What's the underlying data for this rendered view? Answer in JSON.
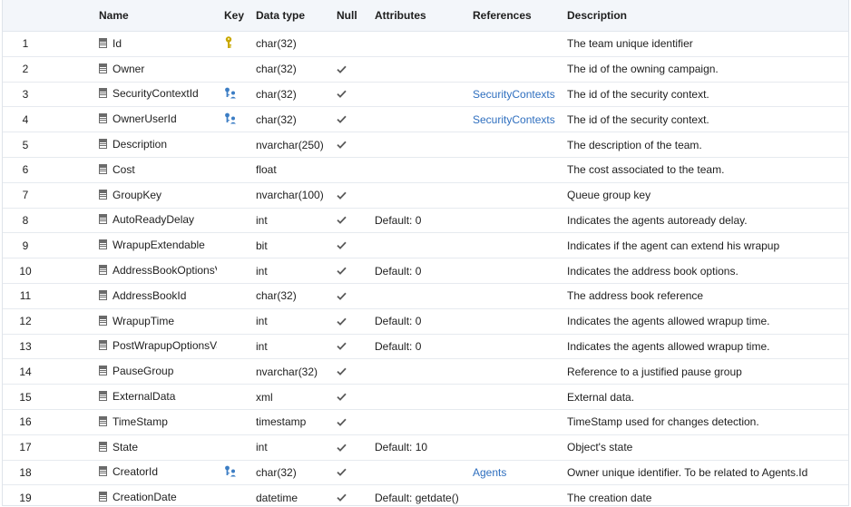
{
  "headers": {
    "num": "",
    "name": "Name",
    "key": "Key",
    "type": "Data type",
    "null": "Null",
    "attributes": "Attributes",
    "references": "References",
    "description": "Description"
  },
  "colors": {
    "accent_link": "#2f6fbf",
    "pk_icon": "#c9a800",
    "fk_icon": "#3b7dc4",
    "check": "#5a5a5a"
  },
  "icons": {
    "column": "column-icon",
    "primary_key": "primary-key-icon",
    "foreign_key": "foreign-key-icon",
    "nullable": "checkmark-icon"
  },
  "rows": [
    {
      "num": "1",
      "name": "Id",
      "key": "pk",
      "type": "char(32)",
      "nullable": false,
      "attributes": "",
      "references": "",
      "description": "The team unique identifier"
    },
    {
      "num": "2",
      "name": "Owner",
      "key": "",
      "type": "char(32)",
      "nullable": true,
      "attributes": "",
      "references": "",
      "description": "The id of the owning campaign."
    },
    {
      "num": "3",
      "name": "SecurityContextId",
      "key": "fk",
      "type": "char(32)",
      "nullable": true,
      "attributes": "",
      "references": "SecurityContexts",
      "description": "The id of the security context."
    },
    {
      "num": "4",
      "name": "OwnerUserId",
      "key": "fk",
      "type": "char(32)",
      "nullable": true,
      "attributes": "",
      "references": "SecurityContexts",
      "description": "The id of the security context."
    },
    {
      "num": "5",
      "name": "Description",
      "key": "",
      "type": "nvarchar(250)",
      "nullable": true,
      "attributes": "",
      "references": "",
      "description": "The description of the team."
    },
    {
      "num": "6",
      "name": "Cost",
      "key": "",
      "type": "float",
      "nullable": false,
      "attributes": "",
      "references": "",
      "description": "The cost associated to the team."
    },
    {
      "num": "7",
      "name": "GroupKey",
      "key": "",
      "type": "nvarchar(100)",
      "nullable": true,
      "attributes": "",
      "references": "",
      "description": "Queue group key"
    },
    {
      "num": "8",
      "name": "AutoReadyDelay",
      "key": "",
      "type": "int",
      "nullable": true,
      "attributes": "Default: 0",
      "references": "",
      "description": "Indicates the agents autoready delay."
    },
    {
      "num": "9",
      "name": "WrapupExtendable",
      "key": "",
      "type": "bit",
      "nullable": true,
      "attributes": "",
      "references": "",
      "description": "Indicates if the agent can extend his wrapup"
    },
    {
      "num": "10",
      "name": "AddressBookOptionsValue",
      "key": "",
      "type": "int",
      "nullable": true,
      "attributes": "Default: 0",
      "references": "",
      "description": "Indicates the address book options."
    },
    {
      "num": "11",
      "name": "AddressBookId",
      "key": "",
      "type": "char(32)",
      "nullable": true,
      "attributes": "",
      "references": "",
      "description": "The address book reference"
    },
    {
      "num": "12",
      "name": "WrapupTime",
      "key": "",
      "type": "int",
      "nullable": true,
      "attributes": "Default: 0",
      "references": "",
      "description": "Indicates the agents allowed wrapup time."
    },
    {
      "num": "13",
      "name": "PostWrapupOptionsValue",
      "key": "",
      "type": "int",
      "nullable": true,
      "attributes": "Default: 0",
      "references": "",
      "description": "Indicates the agents allowed wrapup time."
    },
    {
      "num": "14",
      "name": "PauseGroup",
      "key": "",
      "type": "nvarchar(32)",
      "nullable": true,
      "attributes": "",
      "references": "",
      "description": "Reference to a justified pause group"
    },
    {
      "num": "15",
      "name": "ExternalData",
      "key": "",
      "type": "xml",
      "nullable": true,
      "attributes": "",
      "references": "",
      "description": "External data."
    },
    {
      "num": "16",
      "name": "TimeStamp",
      "key": "",
      "type": "timestamp",
      "nullable": true,
      "attributes": "",
      "references": "",
      "description": "TimeStamp used for changes detection."
    },
    {
      "num": "17",
      "name": "State",
      "key": "",
      "type": "int",
      "nullable": true,
      "attributes": "Default: 10",
      "references": "",
      "description": "Object's state"
    },
    {
      "num": "18",
      "name": "CreatorId",
      "key": "fk",
      "type": "char(32)",
      "nullable": true,
      "attributes": "",
      "references": "Agents",
      "description": "Owner unique identifier. To be related to Agents.Id"
    },
    {
      "num": "19",
      "name": "CreationDate",
      "key": "",
      "type": "datetime",
      "nullable": true,
      "attributes": "Default: getdate()",
      "references": "",
      "description": "The creation date"
    }
  ]
}
